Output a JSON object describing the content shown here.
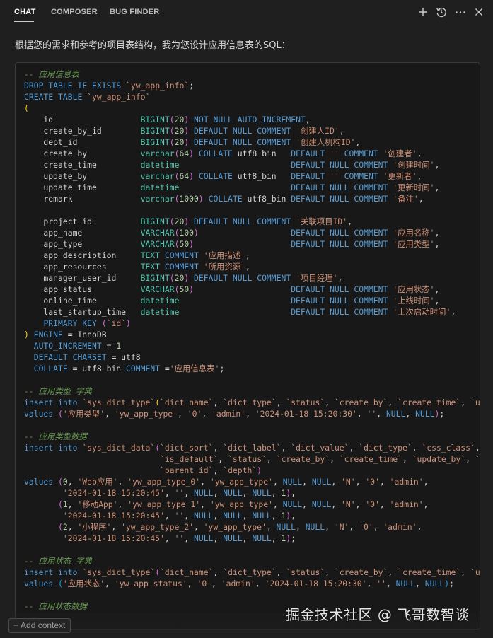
{
  "tabs": [
    {
      "label": "CHAT",
      "active": true
    },
    {
      "label": "COMPOSER",
      "active": false
    },
    {
      "label": "BUG FINDER",
      "active": false
    }
  ],
  "toolbar_icons": [
    "plus-icon",
    "history-icon",
    "more-icon",
    "close-icon"
  ],
  "intro_text": "根据您的需求和参考的项目表结构，我为您设计应用信息表的SQL：",
  "code_lines": [
    "-- 应用信息表",
    "DROP TABLE IF EXISTS `yw_app_info`;",
    "CREATE TABLE `yw_app_info`",
    "(",
    "    id                  BIGINT(20) NOT NULL AUTO_INCREMENT,",
    "    create_by_id        BIGINT(20) DEFAULT NULL COMMENT '创建人ID',",
    "    dept_id             BIGINT(20) DEFAULT NULL COMMENT '创建人机构ID',",
    "    create_by           varchar(64) COLLATE utf8_bin   DEFAULT '' COMMENT '创建者',",
    "    create_time         datetime                       DEFAULT NULL COMMENT '创建时间',",
    "    update_by           varchar(64) COLLATE utf8_bin   DEFAULT '' COMMENT '更新者',",
    "    update_time         datetime                       DEFAULT NULL COMMENT '更新时间',",
    "    remark              varchar(1000) COLLATE utf8_bin DEFAULT NULL COMMENT '备注',",
    "",
    "    project_id          BIGINT(20) DEFAULT NULL COMMENT '关联项目ID',",
    "    app_name            VARCHAR(100)                   DEFAULT NULL COMMENT '应用名称',",
    "    app_type            VARCHAR(50)                    DEFAULT NULL COMMENT '应用类型',",
    "    app_description     TEXT COMMENT '应用描述',",
    "    app_resources       TEXT COMMENT '所用资源',",
    "    manager_user_id     BIGINT(20) DEFAULT NULL COMMENT '项目经理',",
    "    app_status          VARCHAR(50)                    DEFAULT NULL COMMENT '应用状态',",
    "    online_time         datetime                       DEFAULT NULL COMMENT '上线时间',",
    "    last_startup_time   datetime                       DEFAULT NULL COMMENT '上次启动时间',",
    "    PRIMARY KEY (`id`)",
    ") ENGINE = InnoDB",
    "  AUTO_INCREMENT = 1",
    "  DEFAULT CHARSET = utf8",
    "  COLLATE = utf8_bin COMMENT ='应用信息表';",
    "",
    "-- 应用类型 字典",
    "insert into `sys_dict_type`(`dict_name`, `dict_type`, `status`, `create_by`, `create_time`, `upd",
    "values ('应用类型', 'yw_app_type', '0', 'admin', '2024-01-18 15:20:30', '', NULL, NULL);",
    "",
    "-- 应用类型数据",
    "insert into `sys_dict_data`(`dict_sort`, `dict_label`, `dict_value`, `dict_type`, `css_class`, `",
    "                            `is_default`, `status`, `create_by`, `create_time`, `update_by`, `up",
    "                            `parent_id`, `depth`)",
    "values (0, 'Web应用', 'yw_app_type_0', 'yw_app_type', NULL, NULL, 'N', '0', 'admin',",
    "        '2024-01-18 15:20:45', '', NULL, NULL, NULL, 1),",
    "       (1, '移动App', 'yw_app_type_1', 'yw_app_type', NULL, NULL, 'N', '0', 'admin',",
    "        '2024-01-18 15:20:45', '', NULL, NULL, NULL, 1),",
    "       (2, '小程序', 'yw_app_type_2', 'yw_app_type', NULL, NULL, 'N', '0', 'admin',",
    "        '2024-01-18 15:20:45', '', NULL, NULL, NULL, 1);",
    "",
    "-- 应用状态 字典",
    "insert into `sys_dict_type`(`dict_name`, `dict_type`, `status`, `create_by`, `create_time`, `upd",
    "values ('应用状态', 'yw_app_status', '0', 'admin', '2024-01-18 15:20:30', '', NULL, NULL);",
    "",
    "-- 应用状态数据"
  ],
  "add_context_label": "Add context",
  "watermark_text": "掘金技术社区 @ 飞哥数智谈",
  "colors": {
    "background": "#1f1f1f",
    "code_background": "#181818",
    "comment": "#6a9955",
    "keyword": "#569cd6",
    "string": "#ce9178",
    "number": "#b5cea8",
    "type": "#4ec9b0"
  }
}
